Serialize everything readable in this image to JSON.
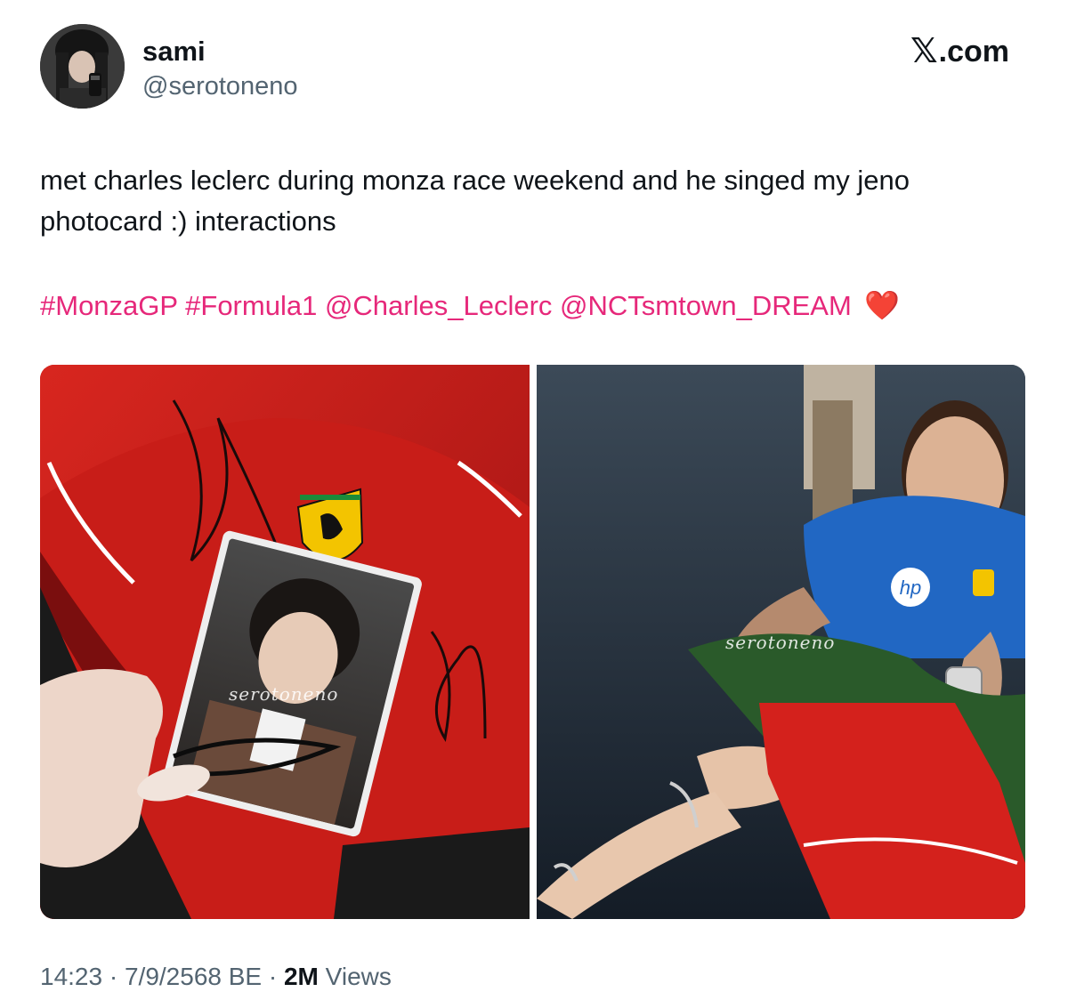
{
  "author": {
    "display_name": "sami",
    "handle": "@serotoneno"
  },
  "brand": {
    "logo_glyph": "𝕏",
    "domain": ".com",
    "icon": "x-logo-icon"
  },
  "tweet": {
    "text": "met charles leclerc during monza race weekend and he singed my jeno photocard :) interactions",
    "tags": [
      "#MonzaGP",
      "#Formula1",
      "@Charles_Leclerc",
      "@NCTsmtown_DREAM"
    ],
    "emoji": "❤️",
    "link_color": "#e6287a"
  },
  "media": {
    "watermark_left": "serotoneno",
    "watermark_right": "serotoneno"
  },
  "meta": {
    "time": "14:23",
    "separator": "·",
    "date": "7/9/2568 BE",
    "views_count": "2M",
    "views_label": "Views"
  }
}
